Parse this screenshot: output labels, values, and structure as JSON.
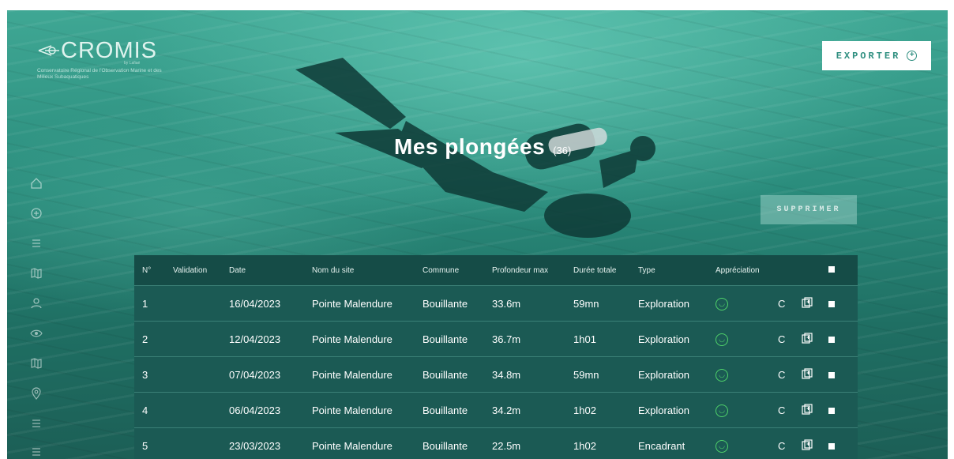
{
  "brand": {
    "name": "CROMIS",
    "sub": "by Lafiaé",
    "tagline": "Conservatoire Régional de l'Observation Marine et des Milieux Subaquatiques"
  },
  "header": {
    "export_label": "EXPORTER",
    "export_icon": "plus-circle-icon"
  },
  "page": {
    "title": "Mes plongées",
    "count": "(36)"
  },
  "actions": {
    "delete_label": "SUPPRIMER"
  },
  "sidebar": {
    "icons": [
      "home-icon",
      "plus-circle-icon",
      "list-icon",
      "map-icon",
      "user-icon",
      "eye-icon",
      "map-icon",
      "location-pin-icon",
      "list-icon",
      "list-icon"
    ]
  },
  "table": {
    "headers": [
      "N°",
      "Validation",
      "Date",
      "Nom du site",
      "Commune",
      "Profondeur max",
      "Durée totale",
      "Type",
      "Appréciation",
      "",
      "",
      ""
    ],
    "rows": [
      {
        "n": "1",
        "validation": "",
        "date": "16/04/2023",
        "site": "Pointe Malendure",
        "commune": "Bouillante",
        "depth": "33.6m",
        "duration": "59mn",
        "type": "Exploration",
        "rating": "smile-icon",
        "code": "C"
      },
      {
        "n": "2",
        "validation": "",
        "date": "12/04/2023",
        "site": "Pointe Malendure",
        "commune": "Bouillante",
        "depth": "36.7m",
        "duration": "1h01",
        "type": "Exploration",
        "rating": "smile-icon",
        "code": "C"
      },
      {
        "n": "3",
        "validation": "",
        "date": "07/04/2023",
        "site": "Pointe Malendure",
        "commune": "Bouillante",
        "depth": "34.8m",
        "duration": "59mn",
        "type": "Exploration",
        "rating": "smile-icon",
        "code": "C"
      },
      {
        "n": "4",
        "validation": "",
        "date": "06/04/2023",
        "site": "Pointe Malendure",
        "commune": "Bouillante",
        "depth": "34.2m",
        "duration": "1h02",
        "type": "Exploration",
        "rating": "smile-icon",
        "code": "C"
      },
      {
        "n": "5",
        "validation": "",
        "date": "23/03/2023",
        "site": "Pointe Malendure",
        "commune": "Bouillante",
        "depth": "22.5m",
        "duration": "1h02",
        "type": "Encadrant",
        "rating": "smile-icon",
        "code": "C"
      }
    ]
  },
  "colors": {
    "accent": "#2f8f80",
    "header_bg": "#154c47",
    "row_bg": "#1b5a54",
    "smile": "#4fd26a"
  }
}
